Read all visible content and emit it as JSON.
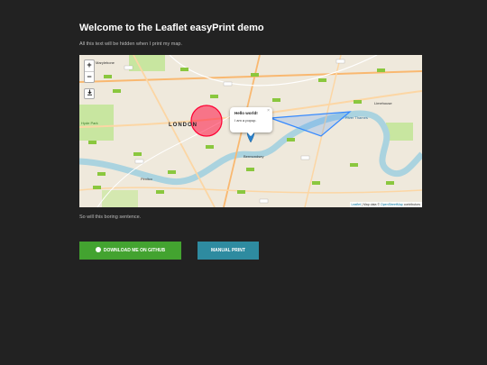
{
  "page": {
    "title": "Welcome to the Leaflet easyPrint demo",
    "intro_text": "All this text will be hidden when I print my map.",
    "outro_text": "So will this boring sentence."
  },
  "map": {
    "zoom_in_label": "+",
    "zoom_out_label": "−",
    "print_control_icon": "download-icon",
    "labels": {
      "marylebone": "Marylebone",
      "london": "LONDON",
      "limehouse": "Limehouse",
      "bermondsey": "Bermondsey",
      "pimlico": "Pimlico",
      "river_thames": "River Thames",
      "hyde_park": "Hyde Park"
    },
    "popup": {
      "title": "Hello world!",
      "body": "I am a popup.",
      "close": "×"
    },
    "attribution": {
      "leaflet": "Leaflet",
      "separator": " | Map data © ",
      "osm": "OpenStreetMap",
      "contributors": " contributors"
    },
    "overlays": {
      "circle_color": "#f03",
      "polygon_color": "#3388ff",
      "marker_color": "#2a81cb"
    }
  },
  "buttons": {
    "github_label": "DOWNLOAD ME ON GITHUB",
    "github_icon": "github-icon",
    "print_label": "MANUAL PRINT"
  },
  "colors": {
    "background": "#222222",
    "github_button": "#43a330",
    "print_button": "#2e8ba0",
    "water": "#aad3df",
    "park": "#c8e6a0"
  }
}
